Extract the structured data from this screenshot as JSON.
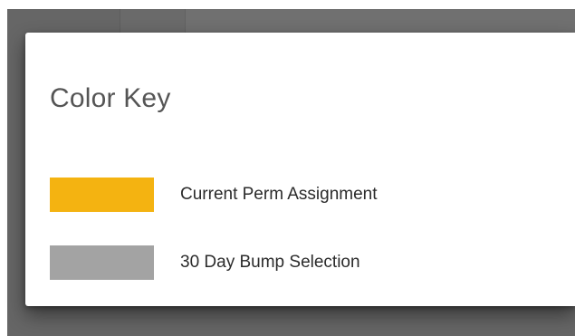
{
  "dialog": {
    "title": "Color Key",
    "items": [
      {
        "label": "Current Perm Assignment",
        "color": "#F4B311"
      },
      {
        "label": "30 Day Bump Selection",
        "color": "#A3A3A3"
      }
    ]
  },
  "colors": {
    "overlay": "#6D6D6D",
    "dialog_background": "#FFFFFF"
  }
}
